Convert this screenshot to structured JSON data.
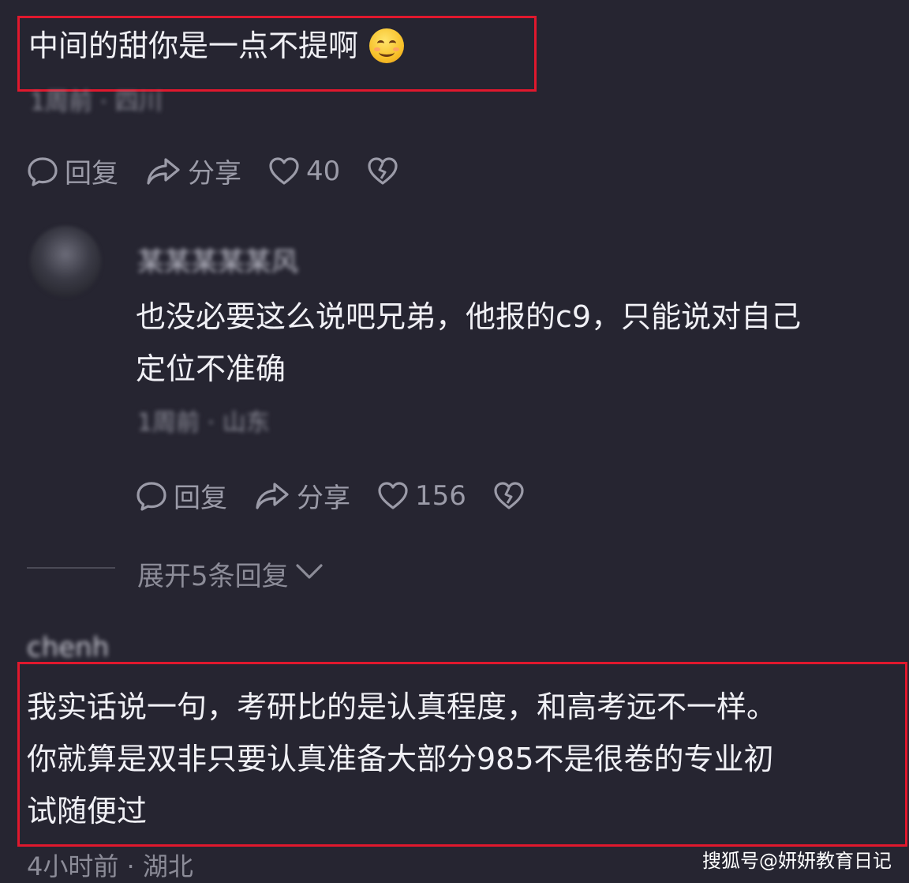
{
  "comment1": {
    "text": "中间的甜你是一点不提啊",
    "emoji": "smiling-blush-emoji",
    "meta_blurred": "1周前 · 四川",
    "actions": {
      "reply": "回复",
      "share": "分享",
      "likes": "40"
    }
  },
  "reply1": {
    "username_blurred": "某某某某某风",
    "text_line1": "也没必要这么说吧兄弟，他报的c9，只能说对自己",
    "text_line2": "定位不准确",
    "meta_blurred": "1周前 · 山东",
    "actions": {
      "reply": "回复",
      "share": "分享",
      "likes": "156"
    }
  },
  "expand": {
    "label": "展开5条回复"
  },
  "comment2": {
    "username_blurred": "chenh",
    "text_line1": "我实话说一句，考研比的是认真程度，和高考远不一样。",
    "text_line2": "你就算是双非只要认真准备大部分985不是很卷的专业初",
    "text_line3": "试随便过",
    "meta": "4小时前 · 湖北"
  },
  "watermark": "搜狐号@妍妍教育日记",
  "colors": {
    "background": "#262531",
    "highlight_box": "#e0182d",
    "muted_text": "#9b9ba8"
  }
}
